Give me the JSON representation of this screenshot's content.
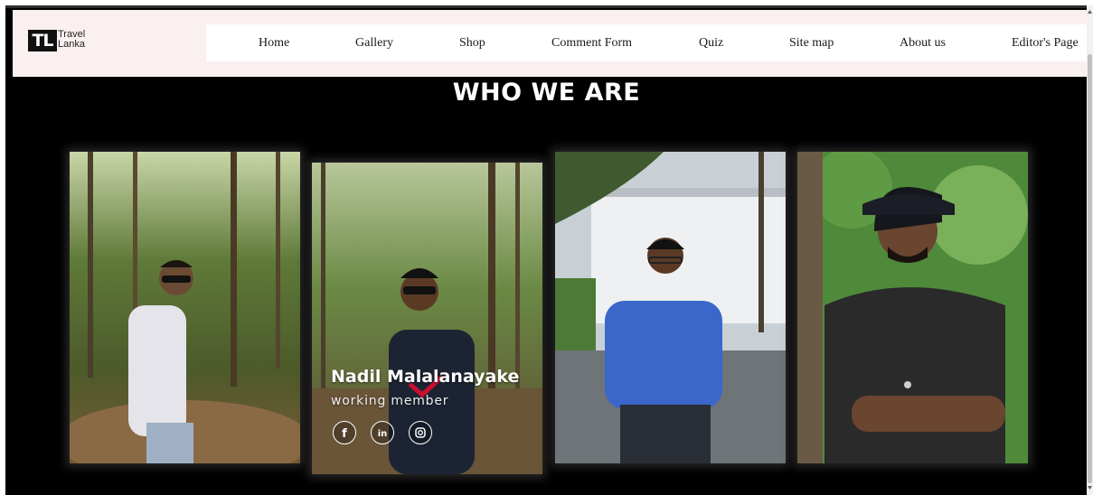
{
  "site": {
    "logo_mark": "TL",
    "logo_line1": "Travel",
    "logo_line2": "Lanka"
  },
  "nav": {
    "items": [
      "Home",
      "Gallery",
      "Shop",
      "Comment Form",
      "Quiz",
      "Site map",
      "About us",
      "Editor's Page"
    ]
  },
  "section": {
    "title": "WHO WE ARE"
  },
  "team": {
    "featured": {
      "name": "Nadil Malalanayake",
      "role": "working member"
    },
    "social_icons": [
      "facebook-icon",
      "linkedin-icon",
      "instagram-icon"
    ]
  },
  "colors": {
    "background": "#000000",
    "header": "#fbf0f0",
    "nav_bg": "#ffffff",
    "title": "#ffffff"
  }
}
